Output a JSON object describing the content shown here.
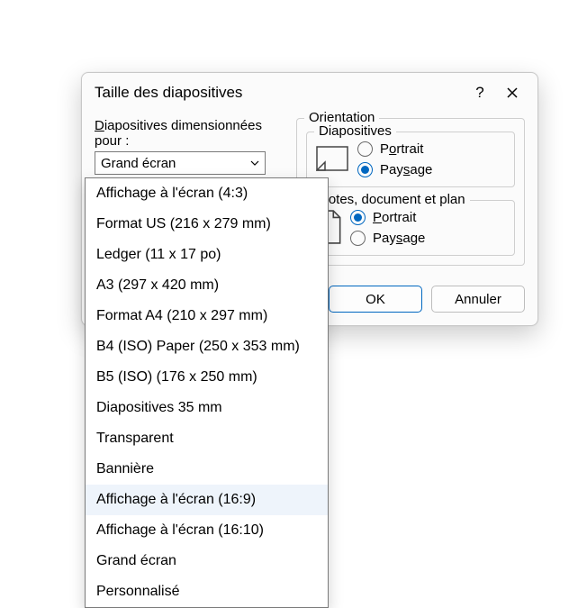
{
  "dialog": {
    "title": "Taille des diapositives"
  },
  "left_panel": {
    "field_label_pre": "D",
    "field_label_rest": "iapositives dimensionnées pour :",
    "combo_value": "Grand écran"
  },
  "orientation": {
    "group_label": "Orientation",
    "slides": {
      "legend": "Diapositives",
      "portrait_pre": "P",
      "portrait_mid": "o",
      "portrait_rest": "rtrait",
      "landscape_pre": "Pay",
      "landscape_mid": "s",
      "landscape_rest": "age",
      "selected": "landscape"
    },
    "notes": {
      "legend": "Notes, document et plan",
      "portrait_pre": "",
      "portrait_mid": "P",
      "portrait_rest": "ortrait",
      "landscape_pre": "Pay",
      "landscape_mid": "s",
      "landscape_rest": "age",
      "selected": "portrait"
    }
  },
  "buttons": {
    "ok": "OK",
    "cancel": "Annuler"
  },
  "dropdown": {
    "items": [
      "Affichage à l'écran (4:3)",
      "Format US (216 x 279 mm)",
      "Ledger (11 x 17 po)",
      "A3 (297 x 420 mm)",
      "Format A4 (210 x 297 mm)",
      "B4 (ISO) Paper (250 x 353 mm)",
      "B5 (ISO) (176 x 250 mm)",
      "Diapositives 35 mm",
      "Transparent",
      "Bannière",
      "Affichage à l'écran (16:9)",
      "Affichage à l'écran (16:10)",
      "Grand écran",
      "Personnalisé"
    ],
    "highlighted_index": 10
  }
}
